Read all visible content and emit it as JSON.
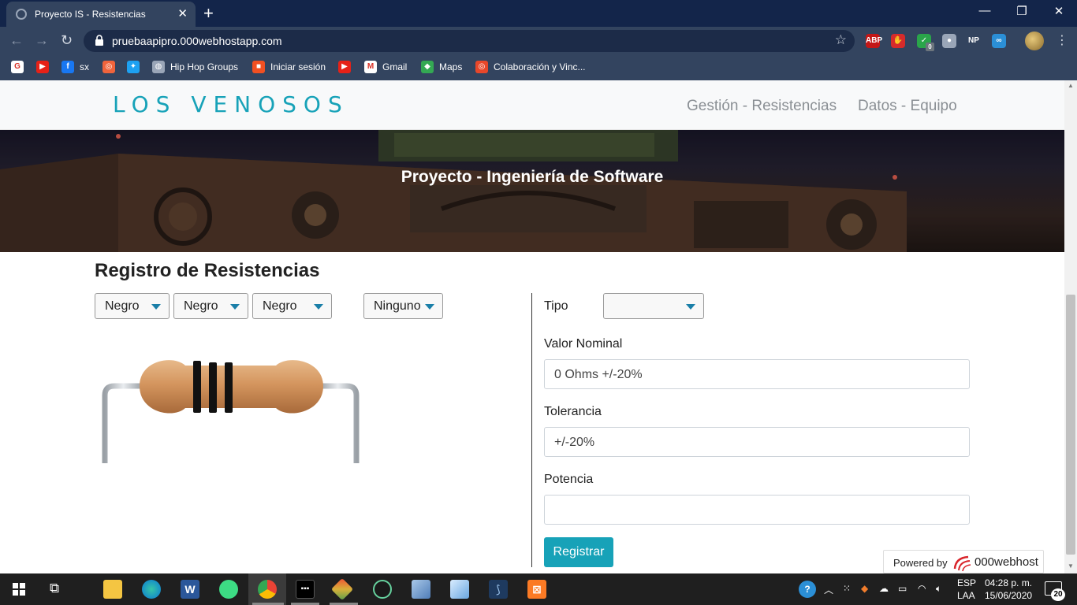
{
  "browser": {
    "tab_title": "Proyecto IS - Resistencias",
    "url": "pruebaapipro.000webhostapp.com",
    "extensions": [
      {
        "name": "abp-icon",
        "text": "ABP",
        "color": "#c41717"
      },
      {
        "name": "hand-stop-icon",
        "text": "✋",
        "color": "#d62b2b"
      },
      {
        "name": "check-badge-icon",
        "text": "✓",
        "color": "#2aa54a"
      },
      {
        "name": "circle-ext-icon",
        "text": "●",
        "color": "#9aa6b8"
      },
      {
        "name": "np-icon",
        "text": "NP",
        "color": "#33445f"
      },
      {
        "name": "infinity-icon",
        "text": "∞",
        "color": "#2b8fd6"
      }
    ],
    "badge_count": "0"
  },
  "bookmarks": [
    {
      "name": "google-icon",
      "label": "",
      "color": "#ffffff",
      "glyph": "G"
    },
    {
      "name": "youtube-icon",
      "label": "",
      "color": "#e62117",
      "glyph": "▶"
    },
    {
      "name": "facebook-icon",
      "label": "sx",
      "color": "#1877f2",
      "glyph": "f"
    },
    {
      "name": "ring-icon",
      "label": "",
      "color": "#f0643c",
      "glyph": "◎"
    },
    {
      "name": "twitter-icon",
      "label": "",
      "color": "#1da1f2",
      "glyph": "✦"
    },
    {
      "name": "globe-icon",
      "label": "Hip Hop Groups",
      "color": "#9aa6b8",
      "glyph": "◍"
    },
    {
      "name": "microsoft-icon",
      "label": "Iniciar sesión",
      "color": "#f25022",
      "glyph": "■"
    },
    {
      "name": "youtube2-icon",
      "label": "",
      "color": "#e62117",
      "glyph": "▶"
    },
    {
      "name": "gmail-icon",
      "label": "Gmail",
      "color": "#ffffff",
      "glyph": "M"
    },
    {
      "name": "maps-icon",
      "label": "Maps",
      "color": "#34a853",
      "glyph": "◆"
    },
    {
      "name": "colab-icon",
      "label": "Colaboración y Vinc...",
      "color": "#e8472a",
      "glyph": "◎"
    }
  ],
  "navbar": {
    "brand": "LOS VENOSOS",
    "links": [
      "Gestión - Resistencias",
      "Datos - Equipo"
    ]
  },
  "hero": {
    "title": "Proyecto - Ingeniería de Software"
  },
  "registro": {
    "title": "Registro de Resistencias",
    "bands": [
      "Negro",
      "Negro",
      "Negro"
    ],
    "tolerance_band": "Ninguno"
  },
  "form": {
    "tipo_label": "Tipo",
    "tipo_value": "",
    "valor_label": "Valor Nominal",
    "valor_value": "0 Ohms +/-20%",
    "tolerancia_label": "Tolerancia",
    "tolerancia_value": "+/-20%",
    "potencia_label": "Potencia",
    "potencia_value": "",
    "submit_label": "Registrar"
  },
  "powered": {
    "prefix": "Powered by",
    "brand": "000webhost"
  },
  "taskbar": {
    "lang_1": "ESP",
    "lang_2": "LAA",
    "time": "04:28 p. m.",
    "date": "15/06/2020",
    "notifications": "20"
  },
  "colors": {
    "accent": "#17a2b8",
    "chrome_frame": "#13254a",
    "chrome_toolbar": "#33445f"
  }
}
